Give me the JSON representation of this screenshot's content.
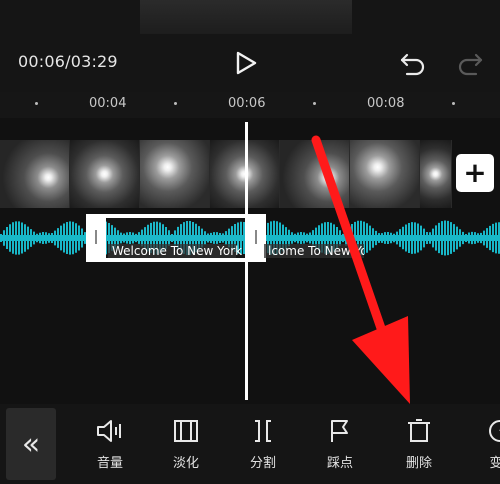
{
  "player": {
    "time_display": "00:06/03:29"
  },
  "ruler": {
    "ticks": [
      "00:04",
      "00:06",
      "00:08"
    ]
  },
  "timeline": {
    "audio_clips": [
      {
        "title": "Welcome To New York",
        "selected": true
      },
      {
        "title": "lcome To New York",
        "selected": false
      }
    ],
    "add_clip_label": "+"
  },
  "toolbar": {
    "collapse_label": "«",
    "tools": [
      {
        "label": "音量",
        "icon": "volume-icon"
      },
      {
        "label": "淡化",
        "icon": "fade-icon"
      },
      {
        "label": "分割",
        "icon": "split-icon"
      },
      {
        "label": "踩点",
        "icon": "flag-icon"
      },
      {
        "label": "删除",
        "icon": "delete-icon"
      },
      {
        "label": "变",
        "icon": "speed-icon"
      }
    ]
  },
  "colors": {
    "waveform": "#18b7c8",
    "annotation_arrow": "#ff1a1a",
    "background": "#121212"
  }
}
